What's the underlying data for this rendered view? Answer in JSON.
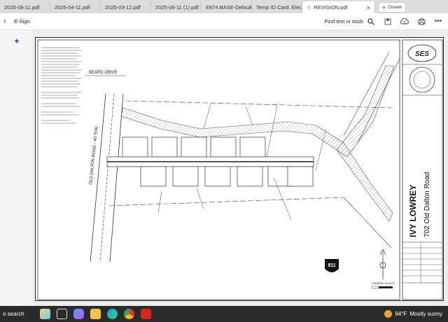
{
  "tabs": [
    {
      "label": "2025-06-11.pdf",
      "active": false
    },
    {
      "label": "2025-04-11.pdf",
      "active": false
    },
    {
      "label": "2025-03-12.pdf",
      "active": false
    },
    {
      "label": "2025-06-11 (1).pdf",
      "active": false
    },
    {
      "label": "E874 BASE-Default...",
      "active": false
    },
    {
      "label": "Temp ID Card, Elec...",
      "active": false
    },
    {
      "label": "REVISION.pdf",
      "active": true,
      "close": "×"
    }
  ],
  "new_tab": {
    "plus": "+",
    "label": "Create"
  },
  "toolbar": {
    "item1": "t",
    "item2": "E-Sign",
    "find": "Find text or tools"
  },
  "drawing": {
    "firm_logo": "SES",
    "project_name": "IVY LOWREY",
    "project_address": "702 Old Dalton Road",
    "street_north": "BEARD DRIVE",
    "street_west": "OLD DALTON ROAD - 40' R/W",
    "utility_logo": "811",
    "scale_label": "GRAPHIC SCALE"
  },
  "taskbar": {
    "search": "o search",
    "temp": "94°F",
    "condition": "Mostly sunny"
  },
  "colors": {
    "accent_purple": "#7a3fd6",
    "taskbar_bg": "#2b2b2b"
  }
}
